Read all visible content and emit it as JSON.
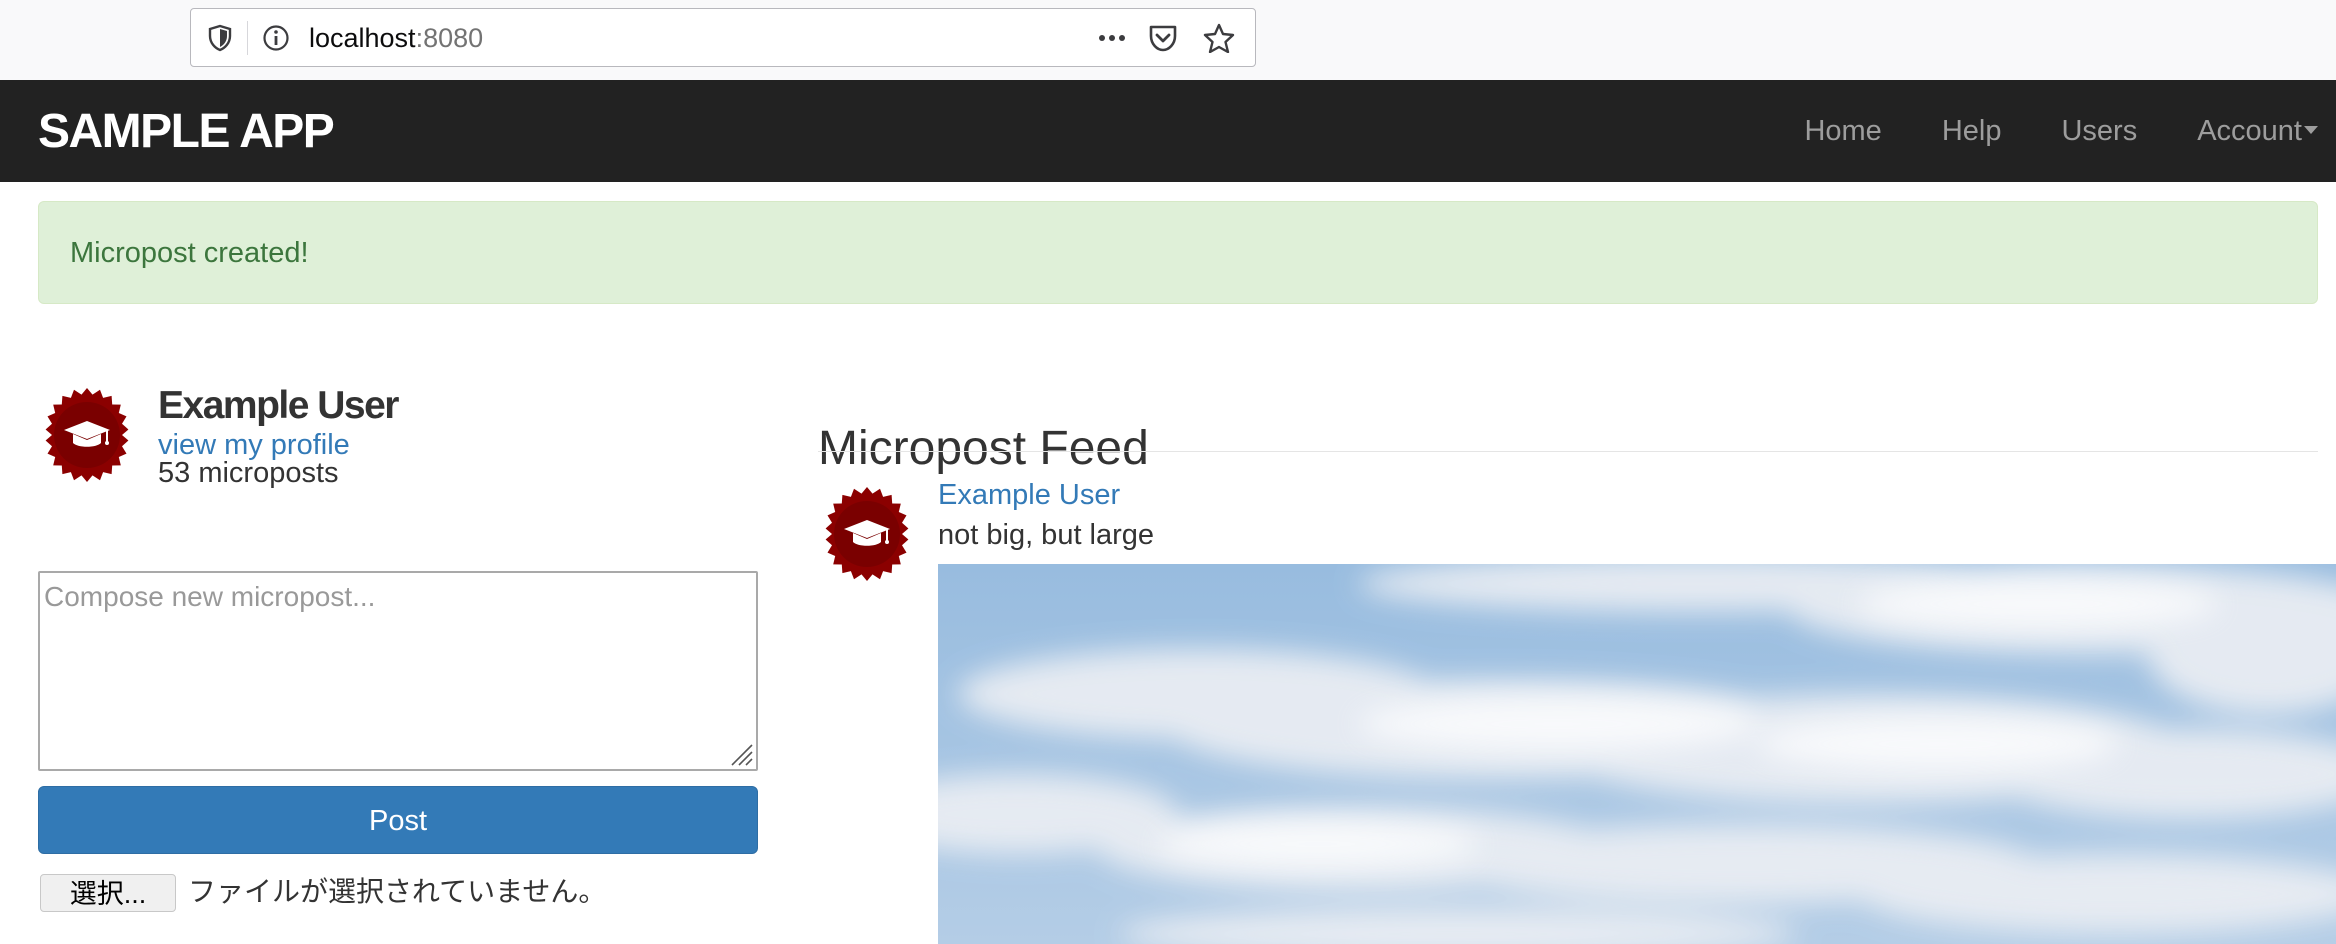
{
  "browser": {
    "url_host": "localhost",
    "url_port": ":8080",
    "icons": [
      "shield-icon",
      "info-icon",
      "more-dots-icon",
      "pocket-icon",
      "star-icon"
    ]
  },
  "navbar": {
    "logo": "SAMPLE APP",
    "links": {
      "home": "Home",
      "help": "Help",
      "users": "Users",
      "account": "Account"
    }
  },
  "flash": {
    "message": "Micropost created!",
    "color": "#3c763d",
    "background": "#dff0d8"
  },
  "sidebar": {
    "user_name": "Example User",
    "profile_link": "view my profile",
    "post_count": "53 microposts",
    "avatar_icon": "graduation-cap-badge-icon"
  },
  "compose": {
    "placeholder": "Compose new micropost...",
    "post_label": "Post",
    "file_button": "選択...",
    "file_status": "ファイルが選択されていません。"
  },
  "feed": {
    "title": "Micropost Feed",
    "items": [
      {
        "user": "Example User",
        "content": "not big, but large",
        "image": "sky-with-clouds"
      }
    ]
  },
  "colors": {
    "navbar": "#222222",
    "link": "#337ab7",
    "primary_button": "#337ab7",
    "avatar": "#8b0000"
  }
}
